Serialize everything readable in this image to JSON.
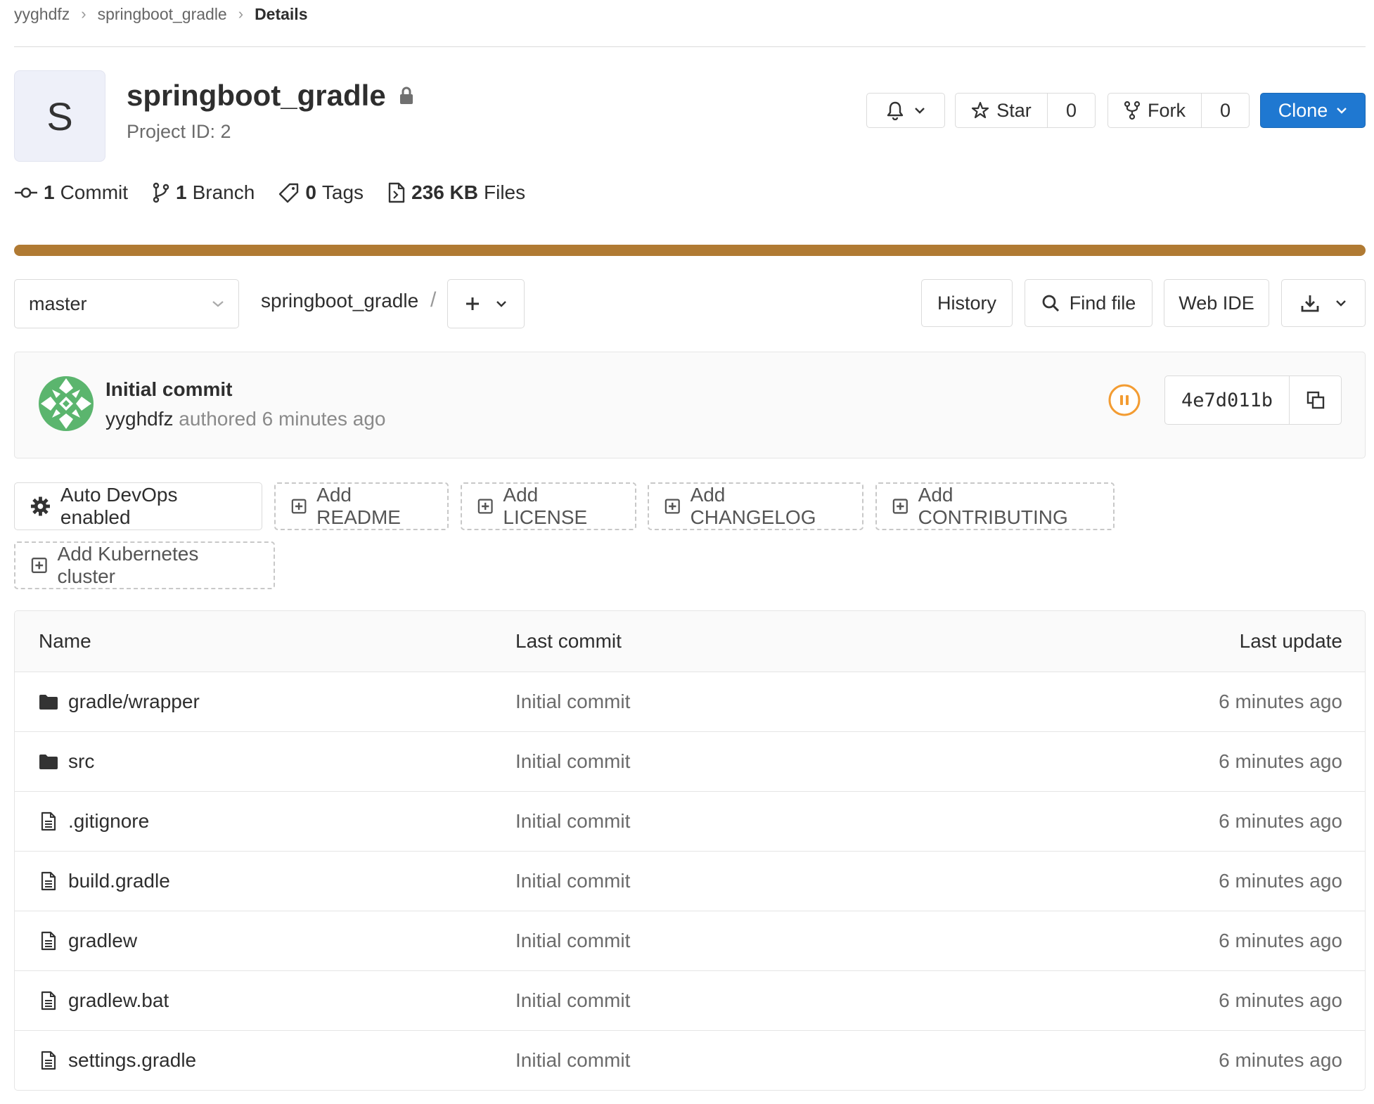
{
  "breadcrumb": {
    "items": [
      "yyghdfz",
      "springboot_gradle"
    ],
    "current": "Details"
  },
  "project": {
    "avatar_letter": "S",
    "name": "springboot_gradle",
    "id_text": "Project ID: 2"
  },
  "actions": {
    "star_label": "Star",
    "star_count": "0",
    "fork_label": "Fork",
    "fork_count": "0",
    "clone_label": "Clone"
  },
  "stats": {
    "commits_count": "1",
    "commits_label": "Commit",
    "branches_count": "1",
    "branches_label": "Branch",
    "tags_count": "0",
    "tags_label": "Tags",
    "files_size": "236 KB",
    "files_label": "Files"
  },
  "language_bar": {
    "color": "#b07a33",
    "fraction": 1.0
  },
  "nav": {
    "branch": "master",
    "path": "springboot_gradle",
    "path_sep": "/",
    "history_label": "History",
    "find_file_label": "Find file",
    "web_ide_label": "Web IDE"
  },
  "last_commit": {
    "title": "Initial commit",
    "author": "yyghdfz",
    "meta": "authored 6 minutes ago",
    "sha": "4e7d011b",
    "pipeline_status": "paused"
  },
  "quick_actions": {
    "autodevops_label": "Auto DevOps enabled",
    "add_readme": "Add README",
    "add_license": "Add LICENSE",
    "add_changelog": "Add CHANGELOG",
    "add_contributing": "Add CONTRIBUTING",
    "add_k8s": "Add Kubernetes cluster"
  },
  "tree": {
    "headers": {
      "name": "Name",
      "last_commit": "Last commit",
      "last_update": "Last update"
    },
    "rows": [
      {
        "name": "gradle/wrapper",
        "type": "folder",
        "commit": "Initial commit",
        "updated": "6 minutes ago"
      },
      {
        "name": "src",
        "type": "folder",
        "commit": "Initial commit",
        "updated": "6 minutes ago"
      },
      {
        "name": ".gitignore",
        "type": "file",
        "commit": "Initial commit",
        "updated": "6 minutes ago"
      },
      {
        "name": "build.gradle",
        "type": "file",
        "commit": "Initial commit",
        "updated": "6 minutes ago"
      },
      {
        "name": "gradlew",
        "type": "file",
        "commit": "Initial commit",
        "updated": "6 minutes ago"
      },
      {
        "name": "gradlew.bat",
        "type": "file",
        "commit": "Initial commit",
        "updated": "6 minutes ago"
      },
      {
        "name": "settings.gradle",
        "type": "file",
        "commit": "Initial commit",
        "updated": "6 minutes ago"
      }
    ]
  }
}
